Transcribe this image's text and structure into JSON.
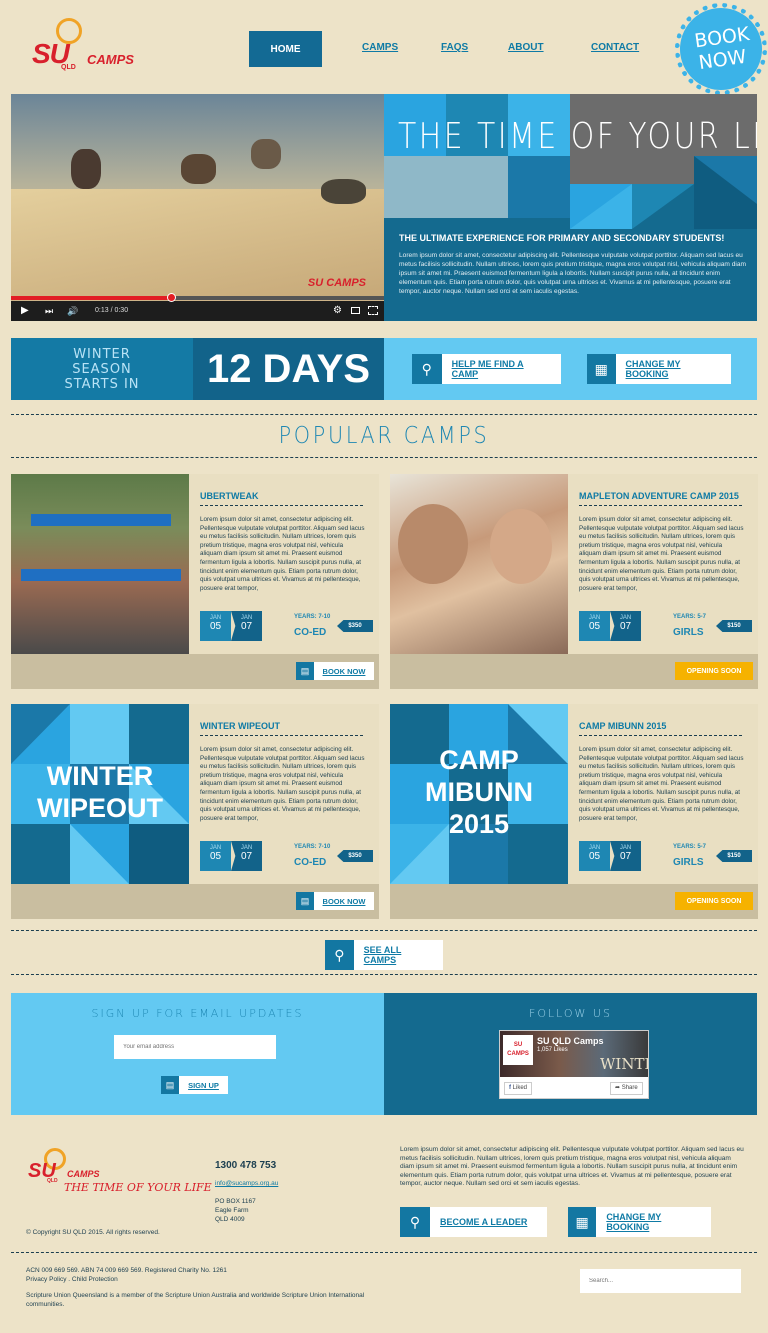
{
  "brand": {
    "su": "SU",
    "camps": "CAMPS",
    "qld": "QLD",
    "tagline": "THE TIME OF YOUR LIFE"
  },
  "nav": {
    "items": [
      "HOME",
      "CAMPS",
      "FAQS",
      "ABOUT",
      "CONTACT"
    ],
    "book_now": "BOOK NOW"
  },
  "hero": {
    "video_time": "0:13 / 0:30",
    "video_progress_fraction": 0.43,
    "title": "THE TIME OF YOUR LIFE",
    "subtitle": "THE ULTIMATE EXPERIENCE FOR PRIMARY AND SECONDARY STUDENTS!",
    "body": "Lorem ipsum dolor sit amet, consectetur adipiscing elit. Pellentesque vulputate volutpat porttitor. Aliquam sed lacus eu metus facilisis sollicitudin. Nullam ultrices, lorem quis pretium tristique, magna eros volutpat nisl, vehicula aliquam diam ipsum sit amet mi. Praesent euismod fermentum ligula a lobortis. Nullam suscipit purus nulla, at tincidunt enim elementum quis. Etiam porta rutrum dolor, quis volutpat urna ultrices et. Vivamus at mi pellentesque, posuere erat tempor, auctor neque. Nullam sed orci et sem iaculis egestas."
  },
  "countdown": {
    "label": "WINTER SEASON STARTS IN",
    "value": "12 DAYS"
  },
  "actions": {
    "find_camp": "HELP ME FIND A CAMP",
    "change_booking": "CHANGE MY BOOKING"
  },
  "popular": {
    "title": "POPULAR CAMPS"
  },
  "camp_body": "Lorem ipsum dolor sit amet, consectetur adipiscing elit. Pellentesque vulputate volutpat porttitor. Aliquam sed lacus eu metus facilisis sollicitudin. Nullam ultrices, lorem quis pretium tristique, magna eros volutpat nisl, vehicula aliquam diam ipsum sit amet mi. Praesent euismod fermentum ligula a lobortis. Nullam suscipit purus nulla, at tincidunt enim elementum quis. Etiam porta rutrum dolor, quis volutpat urna ultrices et. Vivamus at mi pellentesque, posuere erat tempor,",
  "camps": [
    {
      "title": "UBERTWEAK",
      "start_month": "JAN",
      "start_day": "05",
      "end_month": "JAN",
      "end_day": "07",
      "years": "YEARS: 7-10",
      "group": "CO-ED",
      "price": "$350",
      "action": "BOOK NOW"
    },
    {
      "title": "MAPLETON ADVENTURE CAMP 2015",
      "start_month": "JAN",
      "start_day": "05",
      "end_month": "JAN",
      "end_day": "07",
      "years": "YEARS: 5-7",
      "group": "GIRLS",
      "price": "$150",
      "action": "OPENING SOON"
    },
    {
      "title": "WINTER WIPEOUT",
      "tile": "WINTER WIPEOUT",
      "start_month": "JAN",
      "start_day": "05",
      "end_month": "JAN",
      "end_day": "07",
      "years": "YEARS: 7-10",
      "group": "CO-ED",
      "price": "$350",
      "action": "BOOK NOW"
    },
    {
      "title": "CAMP MIBUNN 2015",
      "tile": "CAMP MIBUNN 2015",
      "start_month": "JAN",
      "start_day": "05",
      "end_month": "JAN",
      "end_day": "07",
      "years": "YEARS: 5-7",
      "group": "GIRLS",
      "price": "$150",
      "action": "OPENING SOON"
    }
  ],
  "see_all": "SEE ALL CAMPS",
  "signup": {
    "title": "SIGN UP FOR EMAIL UPDATES",
    "placeholder": "Your email address",
    "button": "SIGN UP"
  },
  "follow": {
    "title": "FOLLOW US",
    "page_name": "SU QLD Camps",
    "likes": "1,057 Likes",
    "liked": "Liked",
    "share": "Share",
    "banner": "WINTER",
    "logo": "SU CAMPS"
  },
  "footer": {
    "phone": "1300 478 753",
    "email": "info@sucamps.org.au",
    "address": [
      "PO BOX 1167",
      "Eagle Farm",
      "QLD 4009"
    ],
    "copyright": "© Copyright SU QLD 2015. All rights reserved.",
    "about": "Lorem ipsum dolor sit amet, consectetur adipiscing elit. Pellentesque vulputate volutpat porttitor. Aliquam sed lacus eu metus facilisis sollicitudin. Nullam ultrices, lorem quis pretium tristique, magna eros volutpat nisl, vehicula aliquam diam ipsum sit amet mi. Praesent euismod fermentum ligula a lobortis. Nullam suscipit purus nulla, at tincidunt enim elementum quis. Etiam porta rutrum dolor, quis volutpat urna ultrices et. Vivamus at mi pellentesque, posuere erat tempor, auctor neque. Nullam sed orci et sem iaculis egestas.",
    "become_leader": "BECOME A LEADER",
    "change_booking": "CHANGE MY BOOKING",
    "legal": "ACN 009 669 569. ABN 74 009 669 569. Registered Charity No. 1261",
    "policy": "Privacy Policy . Child Protection",
    "member": "Scripture Union Queensland is a member of the Scripture Union Australia and worldwide Scripture Union International communities.",
    "search_placeholder": "Search..."
  },
  "colors": {
    "blue_dark": "#136a94",
    "blue_mid": "#1e87b3",
    "blue_light": "#63c9f2",
    "red": "#d8202c",
    "yellow": "#f6b200",
    "paper": "#ede3c8"
  }
}
